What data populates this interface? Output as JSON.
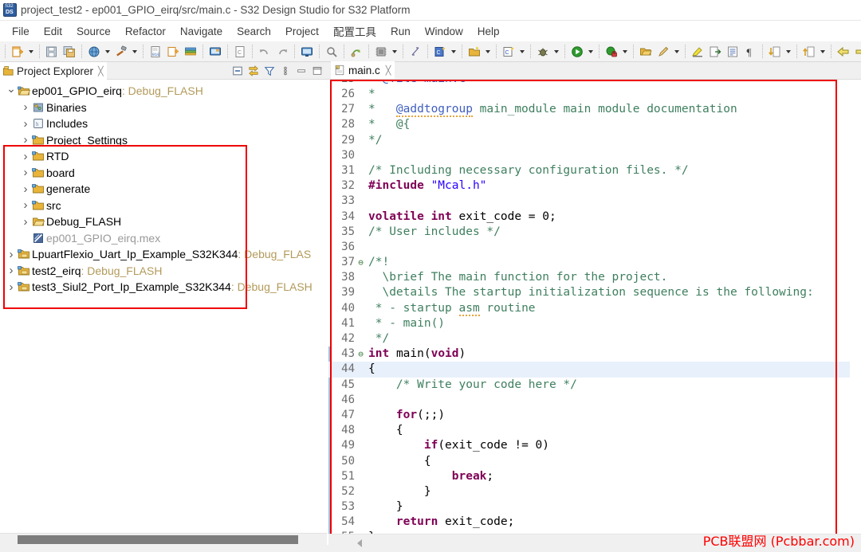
{
  "window": {
    "title": "project_test2 - ep001_GPIO_eirq/src/main.c - S32 Design Studio for S32 Platform",
    "app_icon": "s32ds-icon"
  },
  "menu": {
    "items": [
      "File",
      "Edit",
      "Source",
      "Refactor",
      "Navigate",
      "Search",
      "Project",
      "配置工具",
      "Run",
      "Window",
      "Help"
    ]
  },
  "toolbar": {
    "groups": [
      {
        "buttons": [
          {
            "icon": "new-file-icon",
            "dropdown": true
          }
        ]
      },
      {
        "buttons": [
          {
            "icon": "save-icon",
            "dropdown": false
          },
          {
            "icon": "save-all-icon",
            "dropdown": false
          }
        ]
      },
      {
        "buttons": [
          {
            "icon": "globe-icon",
            "dropdown": true
          },
          {
            "icon": "build-hammer-icon",
            "dropdown": true
          }
        ]
      },
      {
        "buttons": [
          {
            "icon": "binary-file-icon",
            "dropdown": false
          },
          {
            "icon": "new-project-icon",
            "dropdown": false
          },
          {
            "icon": "layers-icon",
            "dropdown": false
          }
        ]
      },
      {
        "buttons": [
          {
            "icon": "console-icon",
            "dropdown": false
          }
        ]
      },
      {
        "buttons": [
          {
            "icon": "c-file-icon",
            "dropdown": false
          }
        ]
      },
      {
        "buttons": [
          {
            "icon": "undo-icon",
            "dropdown": false
          },
          {
            "icon": "redo-icon",
            "dropdown": false
          }
        ]
      },
      {
        "buttons": [
          {
            "icon": "remote-display-icon",
            "dropdown": false
          }
        ]
      },
      {
        "buttons": [
          {
            "icon": "no-search-icon",
            "dropdown": false
          }
        ]
      },
      {
        "buttons": [
          {
            "icon": "flash-program-icon",
            "dropdown": false
          }
        ]
      },
      {
        "buttons": [
          {
            "icon": "chip-icon",
            "dropdown": true
          }
        ]
      },
      {
        "buttons": [
          {
            "icon": "pin-tool-icon",
            "dropdown": false
          }
        ]
      },
      {
        "buttons": [
          {
            "icon": "new-c-project-icon",
            "dropdown": true
          }
        ]
      },
      {
        "buttons": [
          {
            "icon": "new-folder-icon",
            "dropdown": true
          }
        ]
      },
      {
        "buttons": [
          {
            "icon": "new-c-class-icon",
            "dropdown": true
          }
        ]
      },
      {
        "buttons": [
          {
            "icon": "new-element-icon",
            "dropdown": true
          }
        ]
      },
      {
        "buttons": [
          {
            "icon": "debug-bug-icon",
            "dropdown": true
          }
        ]
      },
      {
        "buttons": [
          {
            "icon": "run-icon",
            "dropdown": true
          }
        ]
      },
      {
        "buttons": [
          {
            "icon": "profile-icon",
            "dropdown": true
          }
        ]
      },
      {
        "buttons": [
          {
            "icon": "open-folder-icon",
            "dropdown": false
          },
          {
            "icon": "pencil-icon",
            "dropdown": true
          }
        ]
      },
      {
        "buttons": [
          {
            "icon": "highlight-marker-icon",
            "dropdown": false
          },
          {
            "icon": "export-icon",
            "dropdown": false
          },
          {
            "icon": "list-icon",
            "dropdown": false
          },
          {
            "icon": "pilcrow-icon",
            "dropdown": false
          }
        ]
      },
      {
        "buttons": [
          {
            "icon": "next-annotation-icon",
            "dropdown": true
          }
        ]
      },
      {
        "buttons": [
          {
            "icon": "previous-annotation-icon",
            "dropdown": true
          }
        ]
      },
      {
        "buttons": [
          {
            "icon": "back-edit-icon",
            "dropdown": false
          },
          {
            "icon": "forward-edit-icon",
            "dropdown": false
          },
          {
            "icon": "back-arrow-icon",
            "dropdown": true
          },
          {
            "icon": "forward-arrow-icon",
            "dropdown": true
          }
        ]
      }
    ]
  },
  "project_explorer": {
    "title": "Project Explorer",
    "close_glyph": "╳",
    "tools": [
      {
        "name": "collapse-all-icon"
      },
      {
        "name": "link-with-editor-icon"
      },
      {
        "name": "view-filter-icon"
      },
      {
        "name": "view-menu-icon"
      },
      {
        "name": "minimize-icon"
      },
      {
        "name": "maximize-icon"
      }
    ],
    "tree": [
      {
        "label": "ep001_GPIO_eirq",
        "config": ": Debug_FLASH",
        "icon": "open-project-icon",
        "twisty": "open",
        "indent": 0,
        "grey": false
      },
      {
        "label": "Binaries",
        "config": "",
        "icon": "binaries-icon",
        "twisty": "closed",
        "indent": 1,
        "grey": false
      },
      {
        "label": "Includes",
        "config": "",
        "icon": "includes-icon",
        "twisty": "closed",
        "indent": 1,
        "grey": false
      },
      {
        "label": "Project_Settings",
        "config": "",
        "icon": "src-folder-icon",
        "twisty": "closed",
        "indent": 1,
        "grey": false
      },
      {
        "label": "RTD",
        "config": "",
        "icon": "src-folder-icon",
        "twisty": "closed",
        "indent": 1,
        "grey": false
      },
      {
        "label": "board",
        "config": "",
        "icon": "src-folder-icon",
        "twisty": "closed",
        "indent": 1,
        "grey": false
      },
      {
        "label": "generate",
        "config": "",
        "icon": "src-folder-icon",
        "twisty": "closed",
        "indent": 1,
        "grey": false
      },
      {
        "label": "src",
        "config": "",
        "icon": "src-folder-icon",
        "twisty": "closed",
        "indent": 1,
        "grey": false
      },
      {
        "label": "Debug_FLASH",
        "config": "",
        "icon": "folder-icon",
        "twisty": "closed",
        "indent": 1,
        "grey": false
      },
      {
        "label": "ep001_GPIO_eirq.mex",
        "config": "",
        "icon": "mex-file-icon",
        "twisty": "none",
        "indent": 1,
        "grey": true
      },
      {
        "label": "LpuartFlexio_Uart_Ip_Example_S32K344",
        "config": ": Debug_FLAS",
        "icon": "project-icon",
        "twisty": "closed",
        "indent": 0,
        "grey": false
      },
      {
        "label": "test2_eirq",
        "config": ": Debug_FLASH",
        "icon": "project-icon",
        "twisty": "closed",
        "indent": 0,
        "grey": false
      },
      {
        "label": "test3_Siul2_Port_Ip_Example_S32K344",
        "config": ": Debug_FLASH",
        "icon": "project-icon",
        "twisty": "closed",
        "indent": 0,
        "grey": false
      }
    ]
  },
  "editor": {
    "tab": {
      "label": "main.c",
      "icon": "c-source-file-icon",
      "close_glyph": "╳"
    },
    "current_line": 44,
    "first_visible_line": 25,
    "lines": [
      {
        "n": 25,
        "fold": "",
        "clipped": true,
        "tokens": [
          {
            "t": "  @file main.c",
            "c": "c-doc"
          }
        ]
      },
      {
        "n": 26,
        "fold": "",
        "tokens": [
          {
            "t": "*",
            "c": "c-cmt"
          }
        ]
      },
      {
        "n": 27,
        "fold": "",
        "tokens": [
          {
            "t": "*   ",
            "c": "c-cmt"
          },
          {
            "t": "@addtogroup",
            "c": "c-doc",
            "squiggle": true
          },
          {
            "t": " main_module main module documentation",
            "c": "c-cmt"
          }
        ]
      },
      {
        "n": 28,
        "fold": "",
        "tokens": [
          {
            "t": "*   @{",
            "c": "c-cmt"
          }
        ]
      },
      {
        "n": 29,
        "fold": "",
        "tokens": [
          {
            "t": "*/",
            "c": "c-cmt"
          }
        ]
      },
      {
        "n": 30,
        "fold": "",
        "tokens": [
          {
            "t": "",
            "c": "c-plain"
          }
        ]
      },
      {
        "n": 31,
        "fold": "",
        "tokens": [
          {
            "t": "/* Including necessary configuration files. */",
            "c": "c-cmt"
          }
        ]
      },
      {
        "n": 32,
        "fold": "",
        "tokens": [
          {
            "t": "#include",
            "c": "c-pp"
          },
          {
            "t": " ",
            "c": "c-plain"
          },
          {
            "t": "\"Mcal.h\"",
            "c": "c-str"
          }
        ]
      },
      {
        "n": 33,
        "fold": "",
        "tokens": [
          {
            "t": "",
            "c": "c-plain"
          }
        ]
      },
      {
        "n": 34,
        "fold": "",
        "tokens": [
          {
            "t": "volatile",
            "c": "c-kw"
          },
          {
            "t": " ",
            "c": "c-plain"
          },
          {
            "t": "int",
            "c": "c-kw"
          },
          {
            "t": " exit_code = ",
            "c": "c-plain"
          },
          {
            "t": "0",
            "c": "c-num"
          },
          {
            "t": ";",
            "c": "c-plain"
          }
        ]
      },
      {
        "n": 35,
        "fold": "",
        "tokens": [
          {
            "t": "/* User includes */",
            "c": "c-cmt"
          }
        ]
      },
      {
        "n": 36,
        "fold": "",
        "tokens": [
          {
            "t": "",
            "c": "c-plain"
          }
        ]
      },
      {
        "n": 37,
        "fold": "minus",
        "tokens": [
          {
            "t": "/*!",
            "c": "c-cmt"
          }
        ]
      },
      {
        "n": 38,
        "fold": "",
        "tokens": [
          {
            "t": "  \\brief The main function for the project.",
            "c": "c-cmt"
          }
        ]
      },
      {
        "n": 39,
        "fold": "",
        "tokens": [
          {
            "t": "  \\details The startup initialization sequence is the following:",
            "c": "c-cmt"
          }
        ]
      },
      {
        "n": 40,
        "fold": "",
        "tokens": [
          {
            "t": " * - startup ",
            "c": "c-cmt"
          },
          {
            "t": "asm",
            "c": "c-cmt",
            "squiggle": true
          },
          {
            "t": " routine",
            "c": "c-cmt"
          }
        ]
      },
      {
        "n": 41,
        "fold": "",
        "tokens": [
          {
            "t": " * - main()",
            "c": "c-cmt"
          }
        ]
      },
      {
        "n": 42,
        "fold": "",
        "tokens": [
          {
            "t": " */",
            "c": "c-cmt"
          }
        ]
      },
      {
        "n": 43,
        "fold": "minus",
        "tokens": [
          {
            "t": "int",
            "c": "c-kw"
          },
          {
            "t": " ",
            "c": "c-plain"
          },
          {
            "t": "main",
            "c": "c-plain"
          },
          {
            "t": "(",
            "c": "c-plain"
          },
          {
            "t": "void",
            "c": "c-kw"
          },
          {
            "t": ")",
            "c": "c-plain"
          }
        ]
      },
      {
        "n": 44,
        "fold": "",
        "tokens": [
          {
            "t": "{",
            "c": "c-plain"
          }
        ]
      },
      {
        "n": 45,
        "fold": "",
        "tokens": [
          {
            "t": "    /* Write your code here */",
            "c": "c-cmt"
          }
        ]
      },
      {
        "n": 46,
        "fold": "",
        "tokens": [
          {
            "t": "",
            "c": "c-plain"
          }
        ]
      },
      {
        "n": 47,
        "fold": "",
        "tokens": [
          {
            "t": "    ",
            "c": "c-plain"
          },
          {
            "t": "for",
            "c": "c-kw"
          },
          {
            "t": "(;;)",
            "c": "c-plain"
          }
        ]
      },
      {
        "n": 48,
        "fold": "",
        "tokens": [
          {
            "t": "    {",
            "c": "c-plain"
          }
        ]
      },
      {
        "n": 49,
        "fold": "",
        "tokens": [
          {
            "t": "        ",
            "c": "c-plain"
          },
          {
            "t": "if",
            "c": "c-kw"
          },
          {
            "t": "(exit_code != ",
            "c": "c-plain"
          },
          {
            "t": "0",
            "c": "c-num"
          },
          {
            "t": ")",
            "c": "c-plain"
          }
        ]
      },
      {
        "n": 50,
        "fold": "",
        "tokens": [
          {
            "t": "        {",
            "c": "c-plain"
          }
        ]
      },
      {
        "n": 51,
        "fold": "",
        "tokens": [
          {
            "t": "            ",
            "c": "c-plain"
          },
          {
            "t": "break",
            "c": "c-kw"
          },
          {
            "t": ";",
            "c": "c-plain"
          }
        ]
      },
      {
        "n": 52,
        "fold": "",
        "tokens": [
          {
            "t": "        }",
            "c": "c-plain"
          }
        ]
      },
      {
        "n": 53,
        "fold": "",
        "tokens": [
          {
            "t": "    }",
            "c": "c-plain"
          }
        ]
      },
      {
        "n": 54,
        "fold": "",
        "tokens": [
          {
            "t": "    ",
            "c": "c-plain"
          },
          {
            "t": "return",
            "c": "c-kw"
          },
          {
            "t": " exit_code;",
            "c": "c-plain"
          }
        ]
      },
      {
        "n": 55,
        "fold": "",
        "tokens": [
          {
            "t": "}",
            "c": "c-plain"
          }
        ]
      }
    ]
  },
  "annotations": {
    "boxes": [
      {
        "name": "project-tree-highlight",
        "color": "#ef0000"
      },
      {
        "name": "editor-highlight",
        "color": "#ef0000"
      }
    ]
  },
  "watermark": {
    "text": "PCB联盟网 (Pcbbar.com)",
    "color": "#ff0000"
  }
}
